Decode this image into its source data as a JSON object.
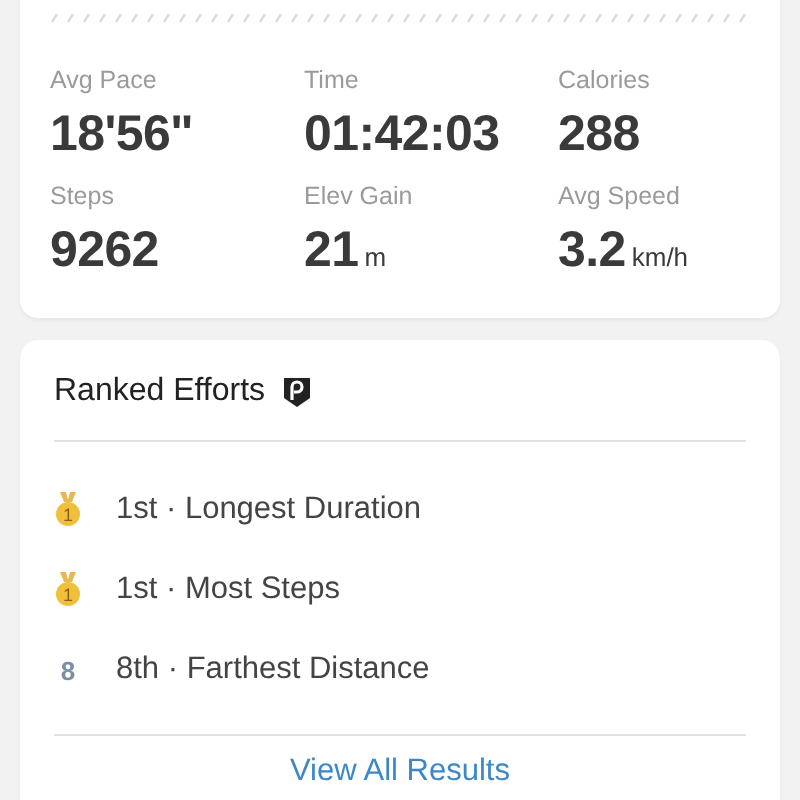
{
  "stats": [
    {
      "label": "Avg Pace",
      "value": "18'56\""
    },
    {
      "label": "Time",
      "value": "01:42:03"
    },
    {
      "label": "Calories",
      "value": "288"
    },
    {
      "label": "Steps",
      "value": "9262"
    },
    {
      "label": "Elev Gain",
      "value": "21",
      "unit": "m"
    },
    {
      "label": "Avg Speed",
      "value": "3.2",
      "unit": "km/h"
    }
  ],
  "ranked_efforts": {
    "title": "Ranked Efforts",
    "items": [
      {
        "kind": "medal",
        "badge": "1",
        "text": "1st · Longest Duration"
      },
      {
        "kind": "medal",
        "badge": "1",
        "text": "1st · Most Steps"
      },
      {
        "kind": "number",
        "badge": "8",
        "text": "8th · Farthest Distance"
      }
    ],
    "link": "View All Results"
  }
}
